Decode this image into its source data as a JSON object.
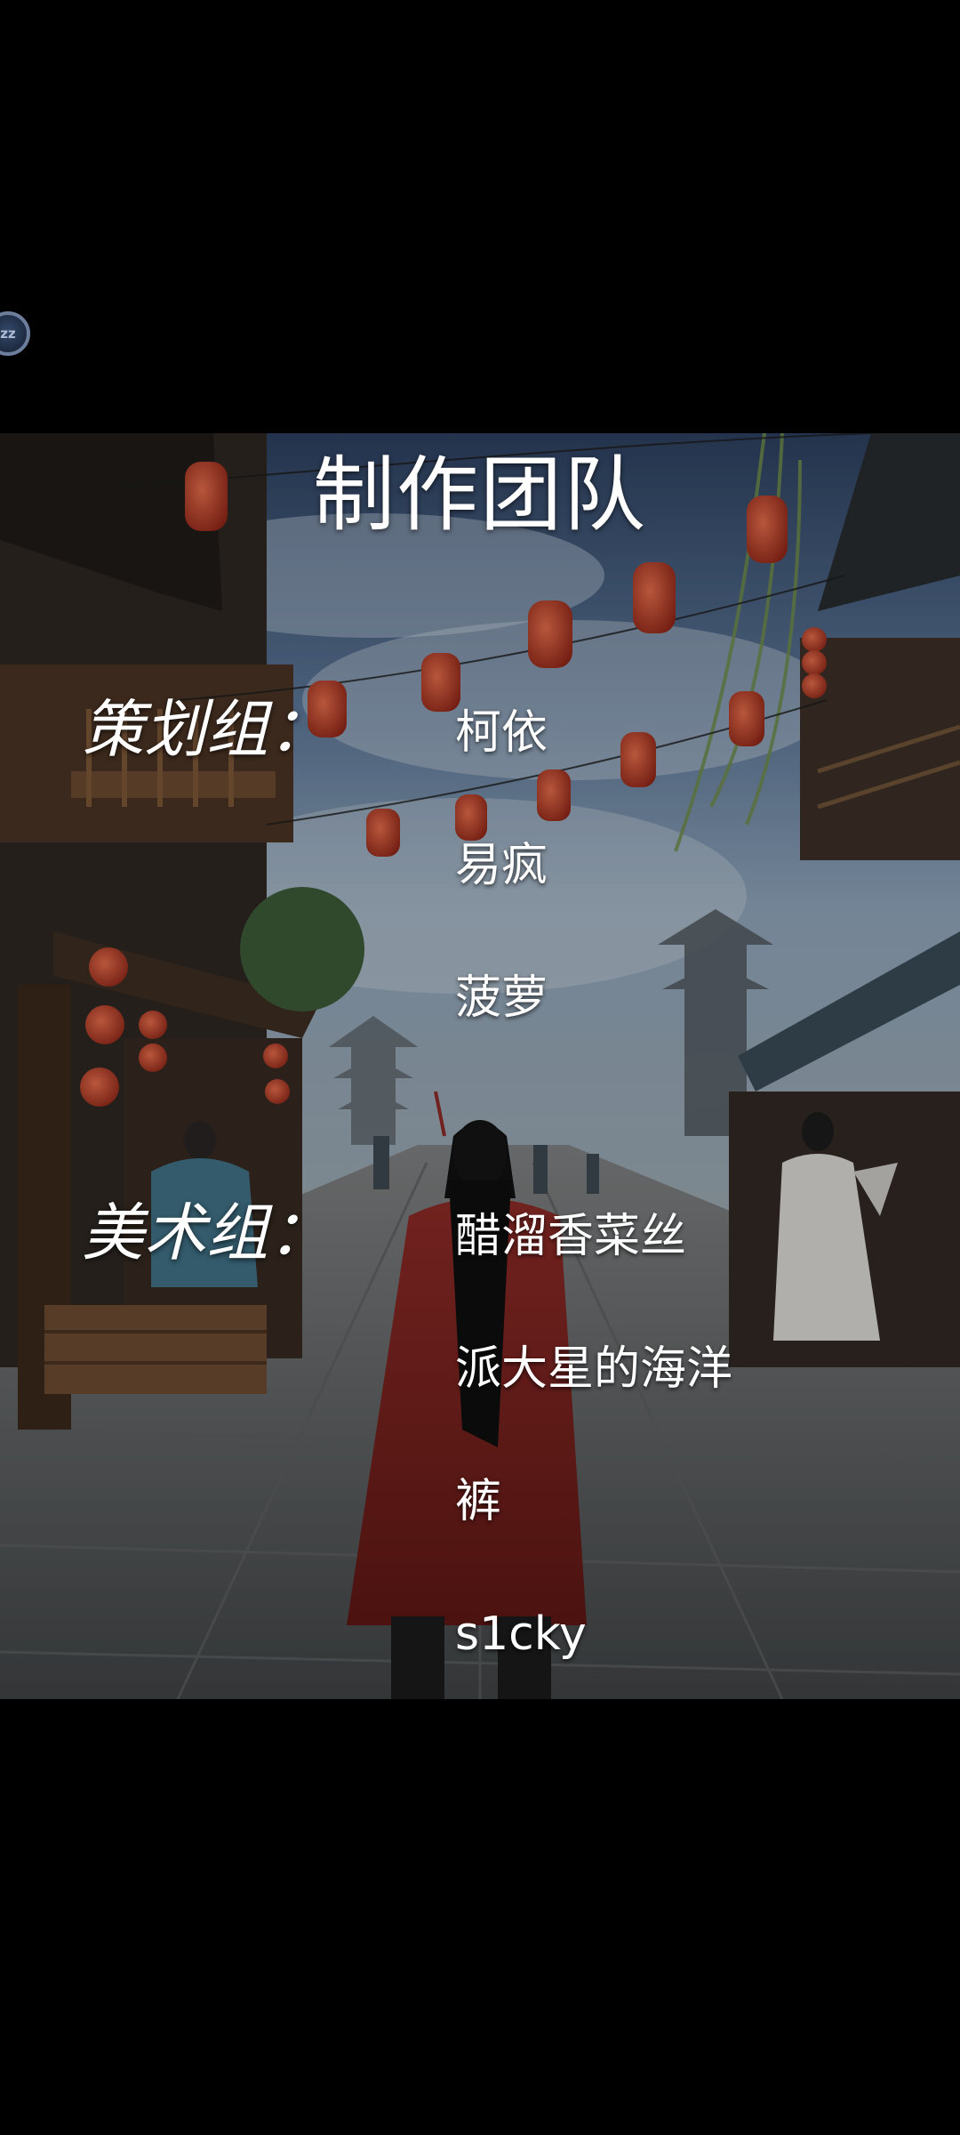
{
  "floating_button": {
    "label": "zz"
  },
  "credits": {
    "title": "制作团队",
    "groups": [
      {
        "label": "策划组：",
        "members": [
          "柯依",
          "易疯",
          "菠萝"
        ]
      },
      {
        "label": "美术组：",
        "members": [
          "醋溜香菜丝",
          "派大星的海洋",
          "裤",
          "s1cky"
        ]
      }
    ]
  }
}
